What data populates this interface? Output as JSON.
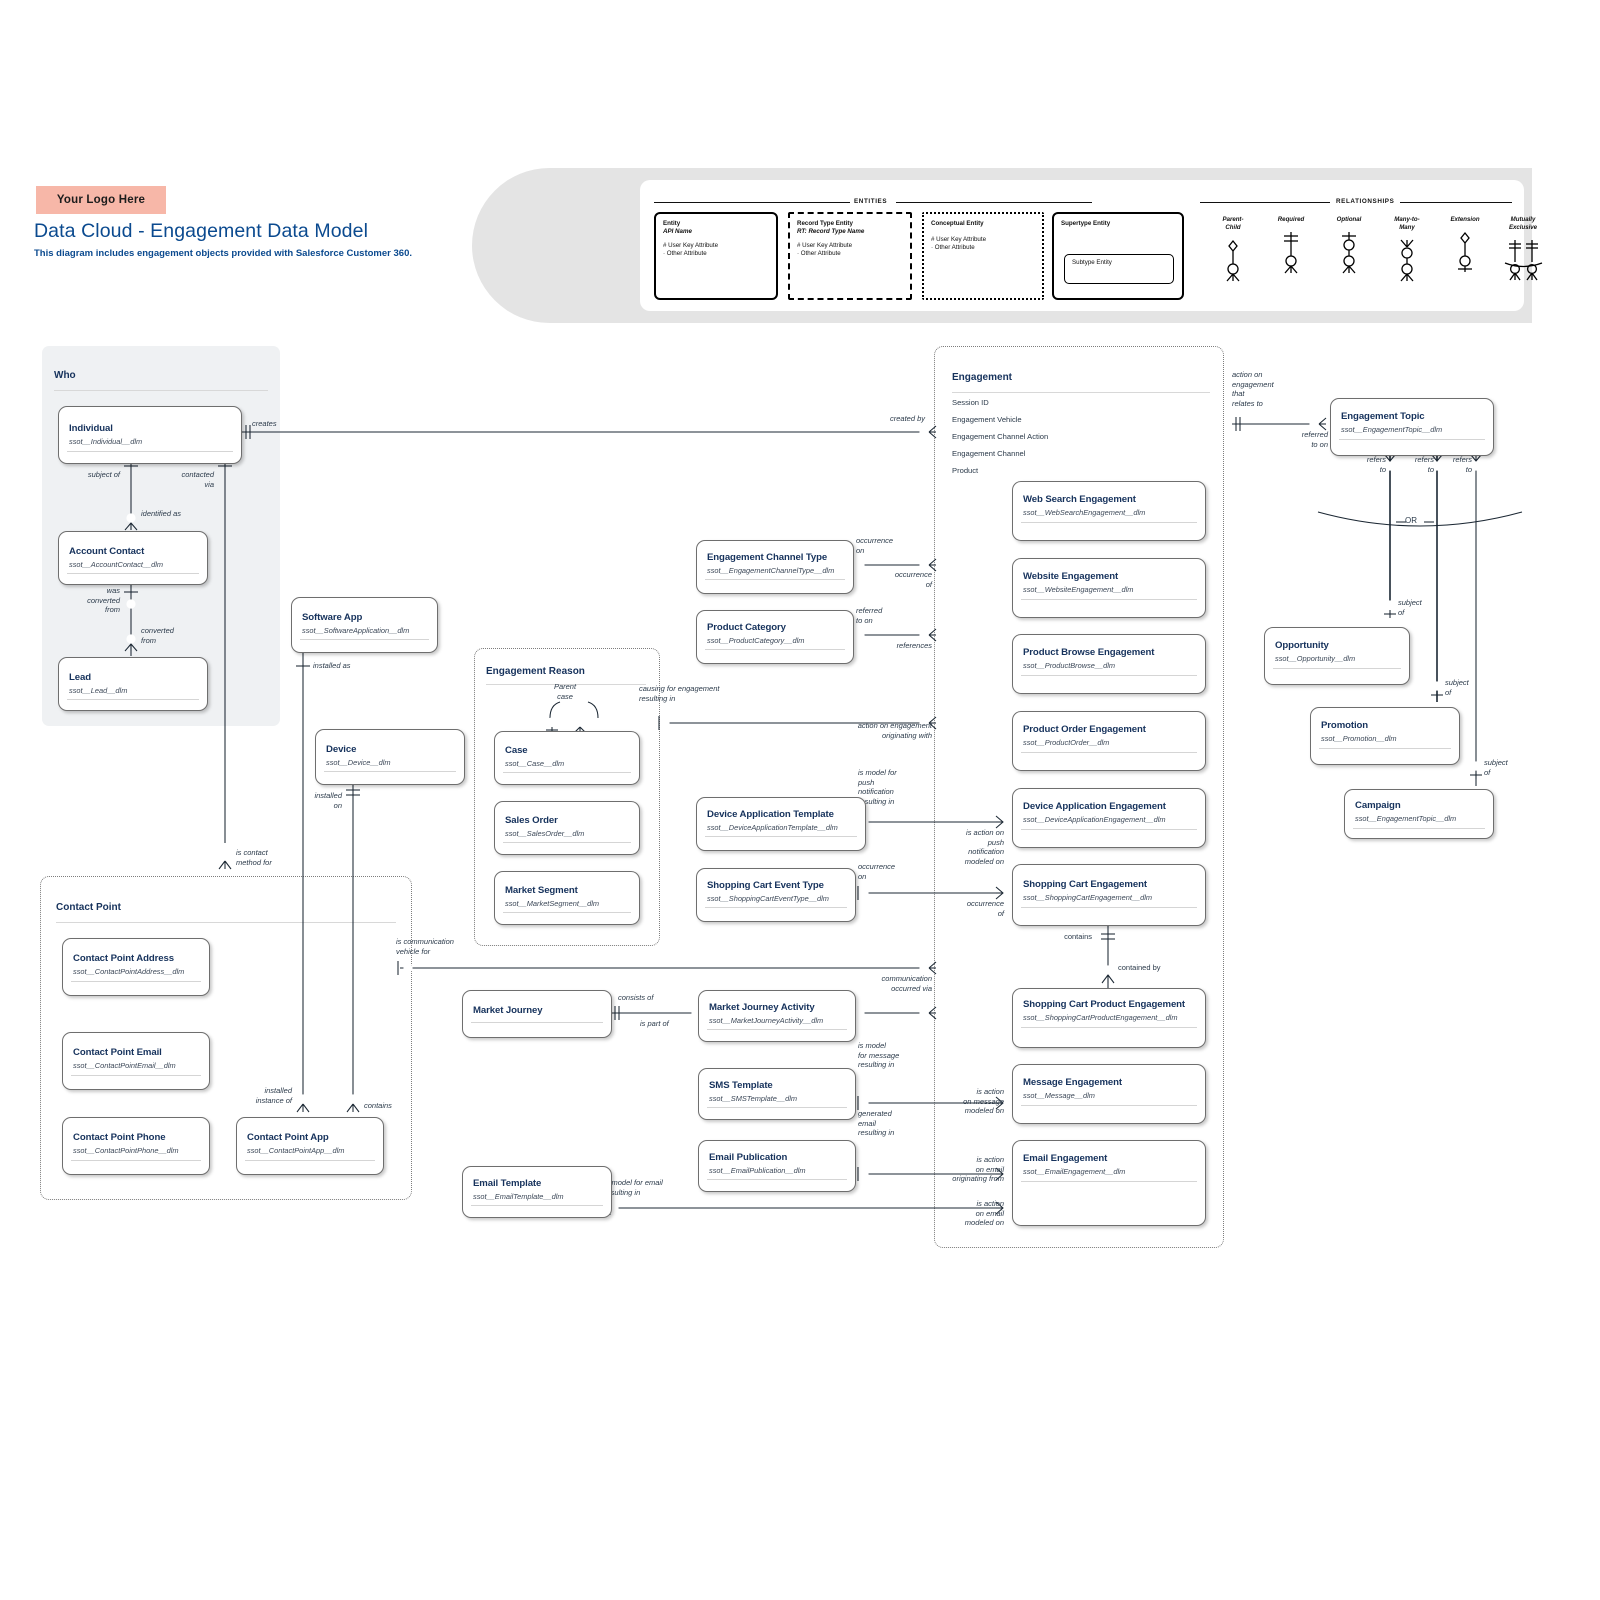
{
  "header": {
    "logo_placeholder": "Your Logo Here",
    "title": "Data Cloud - Engagement Data Model",
    "subtitle": "This diagram includes engagement objects provided with Salesforce Customer 360.",
    "logo_color": "#f7b7a8",
    "title_color": "#0b4a8f"
  },
  "legend": {
    "entities_caption": "ENTITIES",
    "relationships_caption": "RELATIONSHIPS",
    "entity_samples": [
      {
        "name": "Entity",
        "api": "API Name",
        "attr_key": "# User Key Attribute",
        "attr_other": "· Other Attribute",
        "style": "solid"
      },
      {
        "name": "Record Type Entity",
        "api": "RT: Record Type Name",
        "attr_key": "# User Key Attribute",
        "attr_other": "· Other Attribute",
        "style": "dashed"
      },
      {
        "name": "Conceptual Entity",
        "api": "",
        "attr_key": "# User Key Attribute",
        "attr_other": "· Other Attribute",
        "style": "dotted"
      },
      {
        "name": "Supertype Entity",
        "api": "",
        "sub": "Subtype Entity",
        "style": "super"
      }
    ],
    "relationship_types": [
      "Parent-\nChild",
      "Required",
      "Optional",
      "Many-to-\nMany",
      "Extension",
      "Mutually\nExclusive"
    ]
  },
  "groups": [
    {
      "id": "who",
      "title": "Who",
      "style": "gray"
    },
    {
      "id": "contact-point",
      "title": "Contact Point",
      "style": "dotted"
    },
    {
      "id": "engagement-reason",
      "title": "Engagement Reason",
      "style": "dotted"
    },
    {
      "id": "engagement",
      "title": "Engagement",
      "style": "dotted",
      "attributes": [
        "Session ID",
        "Engagement Vehicle",
        "Engagement Channel Action",
        "Engagement Channel",
        "Product"
      ]
    }
  ],
  "entities": [
    {
      "id": "individual",
      "name": "Individual",
      "api": "ssot__Individual__dlm"
    },
    {
      "id": "account-contact",
      "name": "Account Contact",
      "api": "ssot__AccountContact__dlm"
    },
    {
      "id": "lead",
      "name": "Lead",
      "api": "ssot__Lead__dlm"
    },
    {
      "id": "software-app",
      "name": "Software App",
      "api": "ssot__SoftwareApplication__dlm"
    },
    {
      "id": "device",
      "name": "Device",
      "api": "ssot__Device__dlm"
    },
    {
      "id": "cp-address",
      "name": "Contact Point Address",
      "api": "ssot__ContactPointAddress__dlm"
    },
    {
      "id": "cp-email",
      "name": "Contact Point Email",
      "api": "ssot__ContactPointEmail__dlm"
    },
    {
      "id": "cp-phone",
      "name": "Contact Point Phone",
      "api": "ssot__ContactPointPhone__dlm"
    },
    {
      "id": "cp-app",
      "name": "Contact Point App",
      "api": "ssot__ContactPointApp__dlm"
    },
    {
      "id": "case",
      "name": "Case",
      "api": "ssot__Case__dlm"
    },
    {
      "id": "sales-order",
      "name": "Sales Order",
      "api": "ssot__SalesOrder__dlm"
    },
    {
      "id": "market-segment",
      "name": "Market Segment",
      "api": "ssot__MarketSegment__dlm"
    },
    {
      "id": "eng-channel-type",
      "name": "Engagement Channel Type",
      "api": "ssot__EngagementChannelType__dlm"
    },
    {
      "id": "product-category",
      "name": "Product Category",
      "api": "ssot__ProductCategory__dlm"
    },
    {
      "id": "device-app-tmpl",
      "name": "Device Application Template",
      "api": "ssot__DeviceApplicationTemplate__dlm"
    },
    {
      "id": "cart-event-type",
      "name": "Shopping Cart Event Type",
      "api": "ssot__ShoppingCartEventType__dlm"
    },
    {
      "id": "market-journey",
      "name": "Market Journey",
      "api": ""
    },
    {
      "id": "mj-activity",
      "name": "Market Journey Activity",
      "api": "ssot__MarketJourneyActivity__dlm"
    },
    {
      "id": "sms-template",
      "name": "SMS Template",
      "api": "ssot__SMSTemplate__dlm"
    },
    {
      "id": "email-publication",
      "name": "Email Publication",
      "api": "ssot__EmailPublication__dlm"
    },
    {
      "id": "email-template",
      "name": "Email Template",
      "api": "ssot__EmailTemplate__dlm"
    },
    {
      "id": "web-search-eng",
      "name": "Web Search Engagement",
      "api": "ssot__WebSearchEngagement__dlm"
    },
    {
      "id": "website-eng",
      "name": "Website Engagement",
      "api": "ssot__WebsiteEngagement__dlm"
    },
    {
      "id": "product-browse-eng",
      "name": "Product Browse Engagement",
      "api": "ssot__ProductBrowse__dlm"
    },
    {
      "id": "product-order-eng",
      "name": "Product Order Engagement",
      "api": "ssot__ProductOrder__dlm"
    },
    {
      "id": "device-app-eng",
      "name": "Device Application Engagement",
      "api": "ssot__DeviceApplicationEngagement__dlm"
    },
    {
      "id": "cart-eng",
      "name": "Shopping Cart Engagement",
      "api": "ssot__ShoppingCartEngagement__dlm"
    },
    {
      "id": "cart-product-eng",
      "name": "Shopping Cart Product Engagement",
      "api": "ssot__ShoppingCartProductEngagement__dlm"
    },
    {
      "id": "message-eng",
      "name": "Message Engagement",
      "api": "ssot__Message__dlm"
    },
    {
      "id": "email-eng",
      "name": "Email Engagement",
      "api": "ssot__EmailEngagement__dlm"
    },
    {
      "id": "engagement-topic",
      "name": "Engagement Topic",
      "api": "ssot__EngagementTopic__dlm"
    },
    {
      "id": "opportunity",
      "name": "Opportunity",
      "api": "ssot__Opportunity__dlm"
    },
    {
      "id": "promotion",
      "name": "Promotion",
      "api": "ssot__Promotion__dlm"
    },
    {
      "id": "campaign",
      "name": "Campaign",
      "api": "ssot__EngagementTopic__dlm"
    }
  ],
  "relationship_labels": {
    "creates": "creates",
    "subject_of": "subject of",
    "contacted_via": "contacted\nvia",
    "identified_as": "identified as",
    "was_converted_from": "was\nconverted\nfrom",
    "converted_from": "converted\nfrom",
    "installed_as": "installed as",
    "installed_on": "installed\non",
    "is_contact_method_for": "is contact\nmethod for",
    "installed_instance_of": "installed\ninstance of",
    "contains_cpa": "contains",
    "is_communication_vehicle_for": "is communication\nvehicle for",
    "parent_case": "Parent\ncase",
    "occurrence_on_1": "occurrence\non",
    "occurrence_of_1": "occurrence\nof",
    "referred_to_on": "referred\nto on",
    "references": "references",
    "causing_for_engagement_resulting_in": "causing for engagement\nresulting in",
    "action_on_engagement_originating_with": "action on engagement\noriginating with",
    "is_model_for_push": "is model for\npush\nnotification\nresulting in",
    "is_action_on_push": "is action on\npush\nnotification\nmodeled on",
    "occurrence_on_2": "occurrence\non",
    "occurrence_of_2": "occurrence\nof",
    "contains_cart": "contains",
    "contained_by": "contained by",
    "consists_of": "consists of",
    "is_part_of": "is part of",
    "communication_occurred_via": "communication\noccurred via",
    "is_model_for_message": "is model\nfor message\nresulting in",
    "is_action_on_message": "is action\non message\nmodeled on",
    "generated_email_resulting_in": "generated\nemail\nresulting in",
    "is_action_on_email_originating": "is action\non email\noriginating from",
    "is_model_for_email_resulting_in": "is model for email\nresulting in",
    "is_action_on_email_modeled": "is action\non email\nmodeled on",
    "created_by": "created by",
    "action_on_engagement_relates_to": "action on\nengagement\nthat\nrelates to",
    "referred_to_on_topic": "referred\nto on",
    "refers_to": "refers\nto",
    "or": "OR",
    "subject_of_opp": "subject\nof",
    "subject_of_promo": "subject\nof",
    "subject_of_camp": "subject\nof"
  }
}
